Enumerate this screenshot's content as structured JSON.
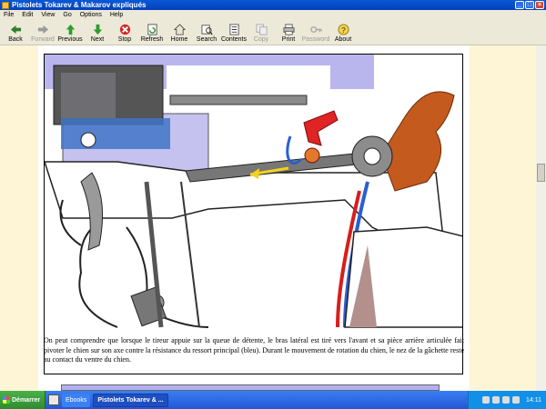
{
  "window": {
    "title": "Pistolets Tokarev & Makarov expliqués"
  },
  "menu": [
    "File",
    "Edit",
    "View",
    "Go",
    "Options",
    "Help"
  ],
  "toolbar": [
    {
      "label": "Back",
      "icon": "back-arrow-icon",
      "enabled": true
    },
    {
      "label": "Forward",
      "icon": "forward-arrow-icon",
      "enabled": false
    },
    {
      "label": "Previous",
      "icon": "up-arrow-icon",
      "enabled": true
    },
    {
      "label": "Next",
      "icon": "down-arrow-icon",
      "enabled": true
    },
    {
      "label": "Stop",
      "icon": "stop-icon",
      "enabled": true
    },
    {
      "label": "Refresh",
      "icon": "refresh-icon",
      "enabled": true
    },
    {
      "label": "Home",
      "icon": "home-icon",
      "enabled": true
    },
    {
      "label": "Search",
      "icon": "search-icon",
      "enabled": true
    },
    {
      "label": "Contents",
      "icon": "contents-icon",
      "enabled": true
    },
    {
      "label": "Copy",
      "icon": "copy-icon",
      "enabled": false
    },
    {
      "label": "Print",
      "icon": "print-icon",
      "enabled": true
    },
    {
      "label": "Password",
      "icon": "key-icon",
      "enabled": false
    },
    {
      "label": "About",
      "icon": "about-icon",
      "enabled": true
    }
  ],
  "content": {
    "paragraph": "On peut comprendre que lorsque le tireur appuie sur la queue de détente, le bras latéral est tiré vers l'avant et sa pièce arrière articulée fait pivoter le chien sur son axe contre la résistance du ressort principal (bleu). Durant le mouvement de rotation du chien, le nez de la gâchette reste au contact du ventre du chien."
  },
  "taskbar": {
    "start": "Démarrer",
    "tasks": [
      {
        "label": "Ebooks",
        "active": false
      },
      {
        "label": "Pistolets Tokarev & ...",
        "active": true
      }
    ],
    "clock": "14:11"
  },
  "colors": {
    "accent_blue": "#2f6fe6",
    "page_bg": "#fdf5d6",
    "diagram_blue": "#2a66d9",
    "diagram_red": "#d71e1e",
    "diagram_orange": "#cf5a1a"
  }
}
